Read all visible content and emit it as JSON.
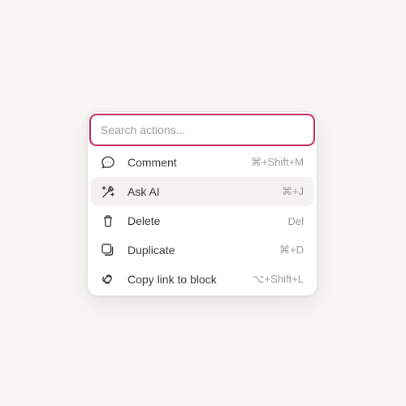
{
  "search": {
    "placeholder": "Search actions..."
  },
  "colors": {
    "accent": "#c8215f",
    "background": "#f7f6f3",
    "active_row": "#f3f2ef",
    "text": "#37352f",
    "muted": "#9b9a97"
  },
  "items": [
    {
      "label": "Comment",
      "shortcut": "⌘+Shift+M",
      "icon": "comment-icon"
    },
    {
      "label": "Ask AI",
      "shortcut": "⌘+J",
      "icon": "ai-wand-icon",
      "active": true
    },
    {
      "label": "Delete",
      "shortcut": "Del",
      "icon": "trash-icon"
    },
    {
      "label": "Duplicate",
      "shortcut": "⌘+D",
      "icon": "duplicate-icon"
    },
    {
      "label": "Copy link to block",
      "shortcut": "⌥+Shift+L",
      "icon": "link-icon"
    }
  ]
}
